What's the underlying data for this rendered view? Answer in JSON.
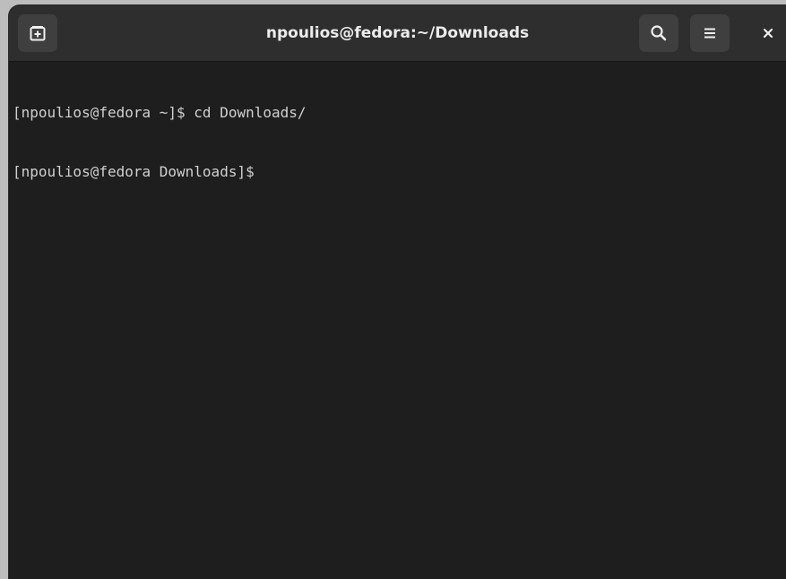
{
  "window": {
    "title": "npoulios@fedora:~/Downloads"
  },
  "headerbar": {
    "buttons": [
      {
        "name": "new-tab",
        "icon": "new-tab-icon"
      },
      {
        "name": "search",
        "icon": "search-icon"
      },
      {
        "name": "menu",
        "icon": "hamburger-menu-icon"
      },
      {
        "name": "close",
        "icon": "close-icon"
      }
    ]
  },
  "terminal": {
    "lines": [
      "[npoulios@fedora ~]$ cd Downloads/",
      "[npoulios@fedora Downloads]$"
    ]
  },
  "colors": {
    "headerbar_bg": "#2e2e2e",
    "button_bg": "#3f3f3f",
    "terminal_bg": "#1e1e1e",
    "terminal_fg": "#d0d0d0",
    "title_fg": "#ececec"
  }
}
